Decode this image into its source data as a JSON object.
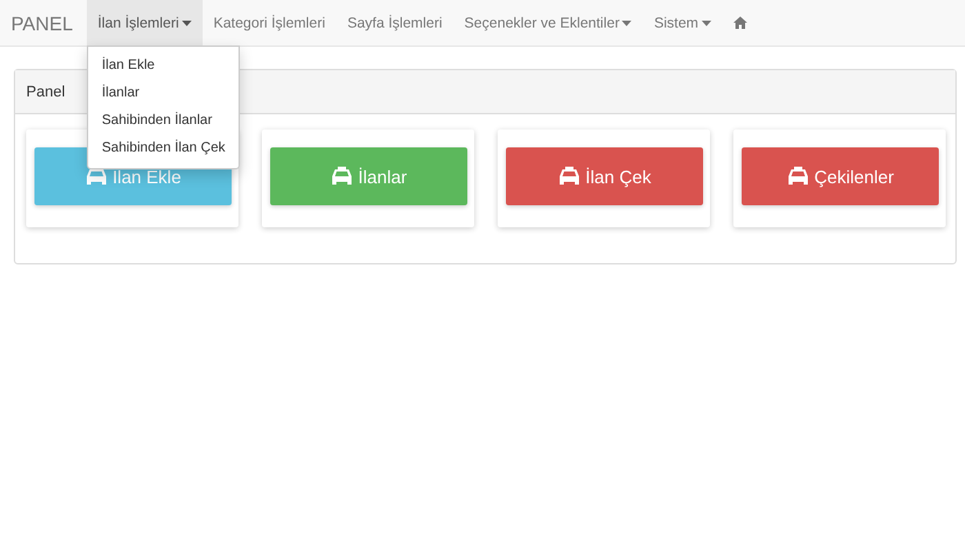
{
  "navbar": {
    "brand": "PANEL",
    "items": [
      {
        "label": "İlan İşlemleri",
        "kind": "dropdown",
        "expanded": true,
        "menu": [
          "İlan Ekle",
          "İlanlar",
          "Sahibinden İlanlar",
          "Sahibinden İlan Çek"
        ]
      },
      {
        "label": "Kategori İşlemleri",
        "kind": "link"
      },
      {
        "label": "Sayfa İşlemleri",
        "kind": "link"
      },
      {
        "label": "Seçenekler ve Eklentiler",
        "kind": "dropdown",
        "expanded": false
      },
      {
        "label": "Sistem",
        "kind": "dropdown",
        "expanded": false
      },
      {
        "kind": "home"
      }
    ]
  },
  "panel": {
    "title": "Panel",
    "tiles": [
      {
        "label": "İlan Ekle",
        "color": "#5bc0de"
      },
      {
        "label": "İlanlar",
        "color": "#5cb85c"
      },
      {
        "label": "İlan Çek",
        "color": "#d9534f"
      },
      {
        "label": "Çekilenler",
        "color": "#d9534f"
      }
    ]
  }
}
